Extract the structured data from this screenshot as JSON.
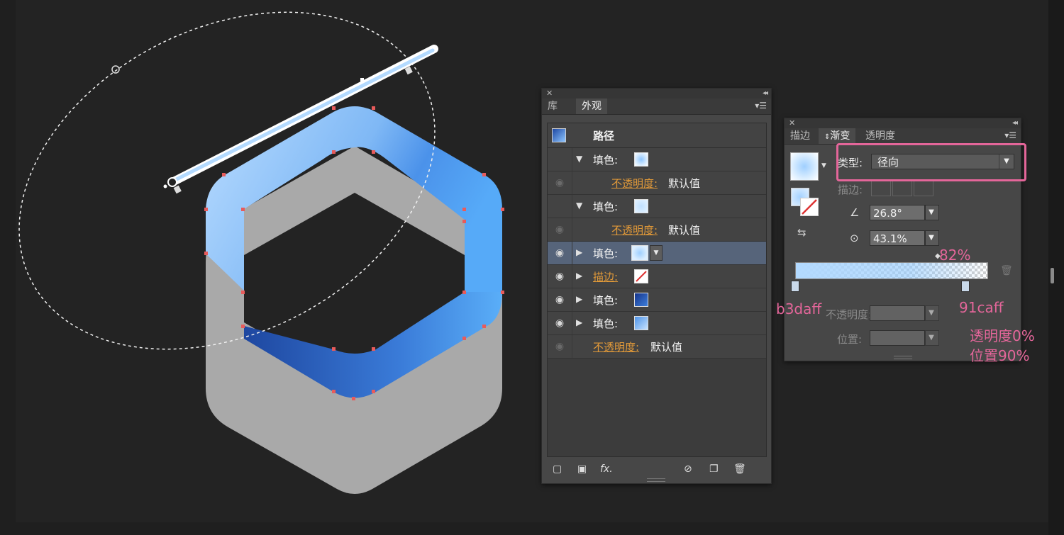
{
  "appearance_panel": {
    "tabs": [
      "库",
      "外观"
    ],
    "active_tab": "外观",
    "object_label": "路径",
    "rows": [
      {
        "kind": "fill",
        "label": "填色:",
        "expanded": true,
        "eye": false,
        "swatch": "radial-light"
      },
      {
        "kind": "opacity",
        "label": "不透明度:",
        "value": "默认值",
        "eye": "dim"
      },
      {
        "kind": "fill",
        "label": "填色:",
        "expanded": true,
        "eye": false,
        "swatch": "light-blue"
      },
      {
        "kind": "opacity",
        "label": "不透明度:",
        "value": "默认值",
        "eye": "dim"
      },
      {
        "kind": "fill",
        "label": "填色:",
        "expanded": false,
        "eye": true,
        "swatch": "radial-light",
        "selected": true
      },
      {
        "kind": "stroke",
        "label": "描边:",
        "expanded": false,
        "eye": true,
        "swatch": "none"
      },
      {
        "kind": "fill",
        "label": "填色:",
        "expanded": false,
        "eye": true,
        "swatch": "dark-blue"
      },
      {
        "kind": "fill",
        "label": "填色:",
        "expanded": false,
        "eye": true,
        "swatch": "light-gradient"
      },
      {
        "kind": "opacity",
        "label": "不透明度:",
        "value": "默认值",
        "eye": "dim",
        "top_level": true
      }
    ],
    "footer_fx": "fx."
  },
  "gradient_panel": {
    "tabs": [
      "描边",
      "渐变",
      "透明度"
    ],
    "active_tab": "渐变",
    "type_label": "类型:",
    "type_value": "径向",
    "stroke_label": "描边:",
    "angle_value": "26.8°",
    "aspect_value": "43.1%",
    "midpoint_value": "82%",
    "opacity_label": "不透明度:",
    "position_label": "位置:"
  },
  "annotations": {
    "left_stop_color": "b3daff",
    "right_stop_color": "91caff",
    "right_stop_opacity": "透明度0%",
    "right_stop_position": "位置90%"
  },
  "colors": {
    "accent_annotation": "#e4669a",
    "gradient_start": "#b3daff",
    "gradient_end": "#91caff",
    "hex_gray": "#a9a9a9",
    "hex_blue": "#4fa6f7",
    "hex_deep": "#1c4aa3"
  }
}
